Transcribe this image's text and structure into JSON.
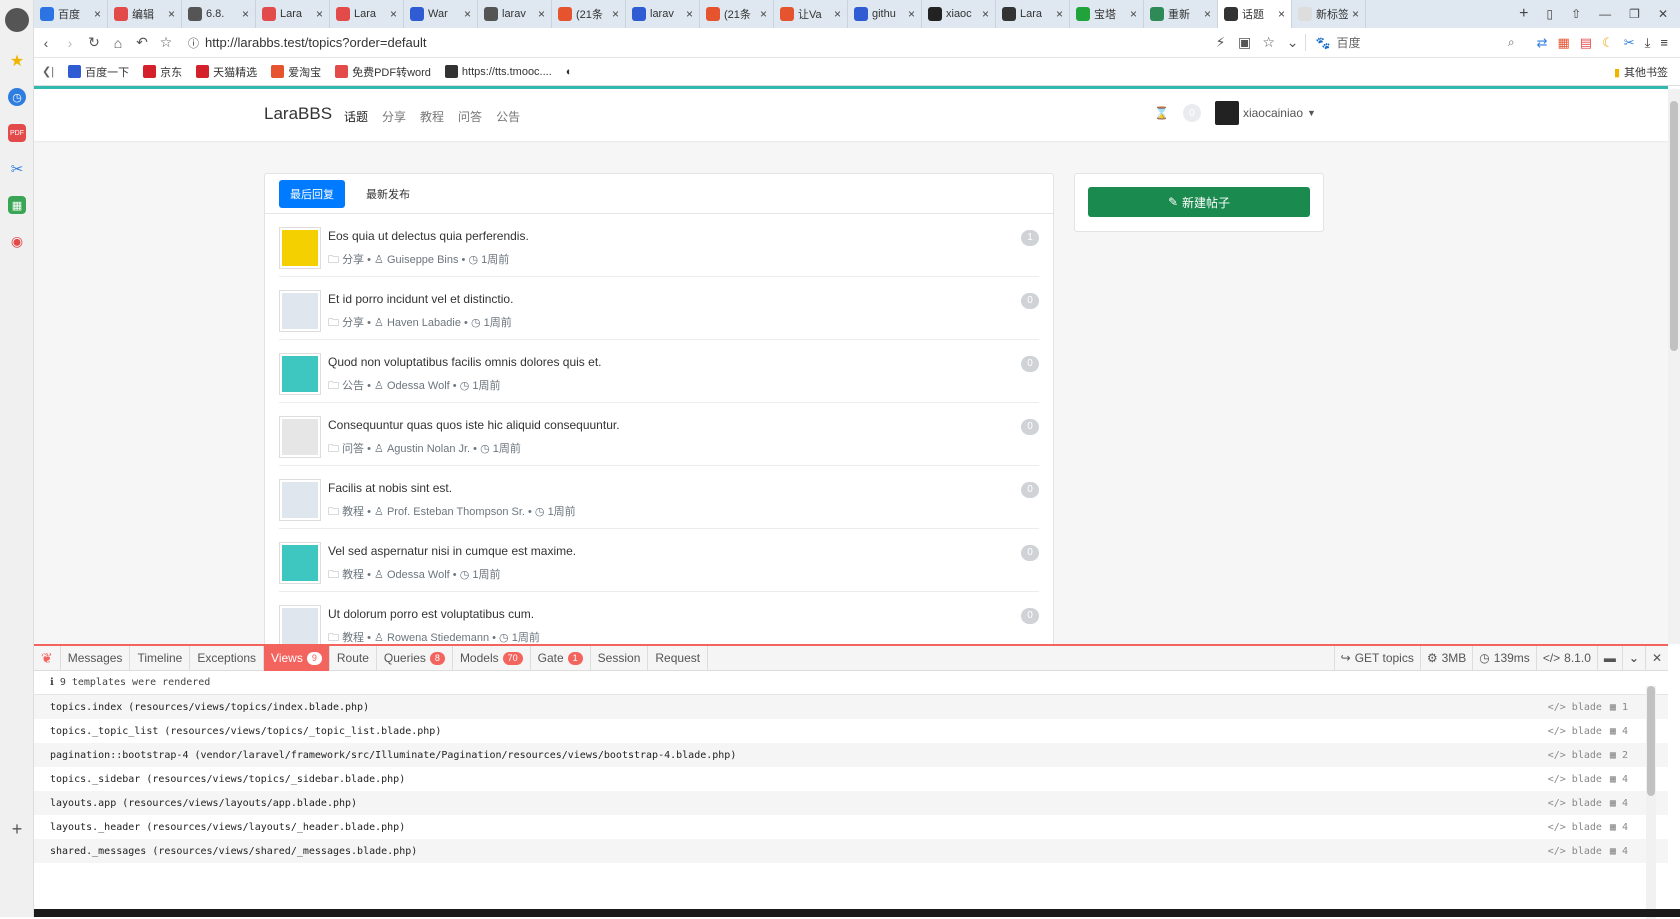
{
  "browser": {
    "tabs": [
      {
        "label": "百度",
        "color": "#2c74e3"
      },
      {
        "label": "编辑",
        "color": "#e34b4b"
      },
      {
        "label": "6.8.",
        "color": "#555555"
      },
      {
        "label": "Lara",
        "color": "#e34b4b"
      },
      {
        "label": "Lara",
        "color": "#e34b4b"
      },
      {
        "label": "War",
        "color": "#2f5bd3"
      },
      {
        "label": "larav",
        "color": "#555555"
      },
      {
        "label": "(21条",
        "color": "#e5532f"
      },
      {
        "label": "larav",
        "color": "#2f5bd3"
      },
      {
        "label": "(21条",
        "color": "#e5532f"
      },
      {
        "label": "让Va",
        "color": "#e5532f"
      },
      {
        "label": "githu",
        "color": "#2f5bd3"
      },
      {
        "label": "xiaoc",
        "color": "#222222"
      },
      {
        "label": "Lara",
        "color": "#333333"
      },
      {
        "label": "宝塔",
        "color": "#21a33b"
      },
      {
        "label": "重新",
        "color": "#2e8b57"
      },
      {
        "label": "话题",
        "color": "#333333",
        "active": true
      },
      {
        "label": "新标签页",
        "color": "#dddddd"
      }
    ],
    "url": "http://larabbs.test/topics?order=default",
    "search_engine": "百度",
    "bookmarks": [
      {
        "label": "百度一下",
        "color": "#2f5bd3"
      },
      {
        "label": "京东",
        "color": "#d3202a"
      },
      {
        "label": "天猫精选",
        "color": "#d3202a"
      },
      {
        "label": "爱淘宝",
        "color": "#e5532f"
      },
      {
        "label": "免费PDF转word",
        "color": "#e34b4b"
      },
      {
        "label": "https://tts.tmooc....",
        "color": "#333333"
      }
    ],
    "other_bookmarks": "其他书签"
  },
  "site": {
    "brand": "LaraBBS",
    "nav": [
      "话题",
      "分享",
      "教程",
      "问答",
      "公告"
    ],
    "notification_count": "0",
    "username": "xiaocainiao",
    "sort_tabs": [
      "最后回复",
      "最新发布"
    ],
    "new_post_button": "新建帖子",
    "topics": [
      {
        "title": "Eos quia ut delectus quia perferendis.",
        "category": "分享",
        "author": "Guiseppe Bins",
        "time": "1周前",
        "replies": "1",
        "avatar_color": "#f4d000"
      },
      {
        "title": "Et id porro incidunt vel et distinctio.",
        "category": "分享",
        "author": "Haven Labadie",
        "time": "1周前",
        "replies": "0",
        "avatar_color": "#dfe6ee"
      },
      {
        "title": "Quod non voluptatibus facilis omnis dolores quis et.",
        "category": "公告",
        "author": "Odessa Wolf",
        "time": "1周前",
        "replies": "0",
        "avatar_color": "#3ec6c1"
      },
      {
        "title": "Consequuntur quas quos iste hic aliquid consequuntur.",
        "category": "问答",
        "author": "Agustin Nolan Jr.",
        "time": "1周前",
        "replies": "0",
        "avatar_color": "#e6e6e6"
      },
      {
        "title": "Facilis at nobis sint est.",
        "category": "教程",
        "author": "Prof. Esteban Thompson Sr.",
        "time": "1周前",
        "replies": "0",
        "avatar_color": "#dfe6ee"
      },
      {
        "title": "Vel sed aspernatur nisi in cumque est maxime.",
        "category": "教程",
        "author": "Odessa Wolf",
        "time": "1周前",
        "replies": "0",
        "avatar_color": "#3ec6c1"
      },
      {
        "title": "Ut dolorum porro est voluptatibus cum.",
        "category": "教程",
        "author": "Rowena Stiedemann",
        "time": "1周前",
        "replies": "0",
        "avatar_color": "#dfe6ee"
      }
    ]
  },
  "debugbar": {
    "tabs": [
      {
        "label": "Messages"
      },
      {
        "label": "Timeline"
      },
      {
        "label": "Exceptions"
      },
      {
        "label": "Views",
        "badge": "9",
        "active": true
      },
      {
        "label": "Route"
      },
      {
        "label": "Queries",
        "badge": "8"
      },
      {
        "label": "Models",
        "badge": "70"
      },
      {
        "label": "Gate",
        "badge": "1"
      },
      {
        "label": "Session"
      },
      {
        "label": "Request"
      }
    ],
    "route": "GET topics",
    "memory": "3MB",
    "duration": "139ms",
    "php_version": "8.1.0",
    "info": "9 templates were rendered",
    "views": [
      {
        "name": "topics.index (resources/views/topics/index.blade.php)",
        "type": "blade",
        "params": "1"
      },
      {
        "name": "topics._topic_list (resources/views/topics/_topic_list.blade.php)",
        "type": "blade",
        "params": "4"
      },
      {
        "name": "pagination::bootstrap-4 (vendor/laravel/framework/src/Illuminate/Pagination/resources/views/bootstrap-4.blade.php)",
        "type": "blade",
        "params": "2"
      },
      {
        "name": "topics._sidebar (resources/views/topics/_sidebar.blade.php)",
        "type": "blade",
        "params": "4"
      },
      {
        "name": "layouts.app (resources/views/layouts/app.blade.php)",
        "type": "blade",
        "params": "4"
      },
      {
        "name": "layouts._header (resources/views/layouts/_header.blade.php)",
        "type": "blade",
        "params": "4"
      },
      {
        "name": "shared._messages (resources/views/shared/_messages.blade.php)",
        "type": "blade",
        "params": "4"
      }
    ]
  }
}
